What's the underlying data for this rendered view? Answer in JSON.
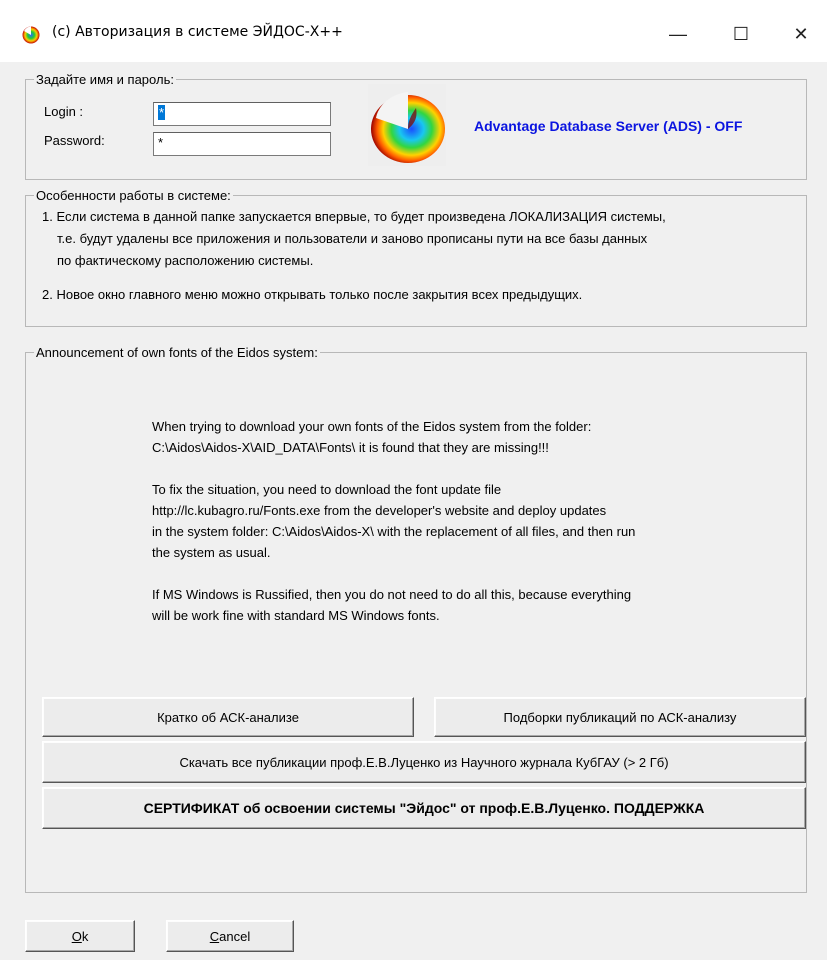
{
  "window": {
    "title": "(c) Авторизация в системе ЭЙДОС-Х++",
    "minimize_glyph": "—",
    "maximize_glyph": "☐",
    "close_glyph": "✕"
  },
  "credentials": {
    "legend": "Задайте имя и пароль:",
    "login_label": "Login  :",
    "login_value": "*",
    "password_label": "Password:",
    "password_value": "*"
  },
  "ads_status": "Advantage Database Server (ADS) - OFF",
  "features": {
    "legend": "Особенности работы в системе:",
    "item1_line1": "1. Если система в данной папке запускается впервые, то будет произведена ЛОКАЛИЗАЦИЯ системы,",
    "item1_line2": "т.е. будут удалены все приложения и пользователи и заново прописаны пути на все базы данных",
    "item1_line3": "по фактическому расположению системы.",
    "item2": "2. Новое окно главного меню можно открывать только после закрытия всех предыдущих."
  },
  "announcement": {
    "legend": "Announcement of own fonts of the Eidos system:",
    "lines": [
      "When trying to download your own fonts of the Eidos system from the folder:",
      "C:\\Aidos\\Aidos-X\\AID_DATA\\Fonts\\ it is found that they are missing!!!",
      "",
      "To fix the situation, you need to download the font update file",
      "http://lc.kubagro.ru/Fonts.exe from the developer's website and deploy updates",
      "in the system folder: C:\\Aidos\\Aidos-X\\ with the replacement of all files, and then run",
      "the system as usual.",
      "",
      "If MS Windows is Russified, then you do not need to do all this, because everything",
      "will be work fine with standard MS Windows fonts."
    ]
  },
  "buttons": {
    "brief": "Кратко об АСК-анализе",
    "publications": "Подборки публикаций по АСК-анализу",
    "download_all": "Скачать все публикации проф.Е.В.Луценко из Научного журнала КубГАУ (> 2 Гб)",
    "certificate": "СЕРТИФИКАТ об освоении системы \"Эйдос\" от проф.Е.В.Луценко. ПОДДЕРЖКА",
    "ok_key": "O",
    "ok_rest": "k",
    "cancel_key": "C",
    "cancel_rest": "ancel"
  }
}
